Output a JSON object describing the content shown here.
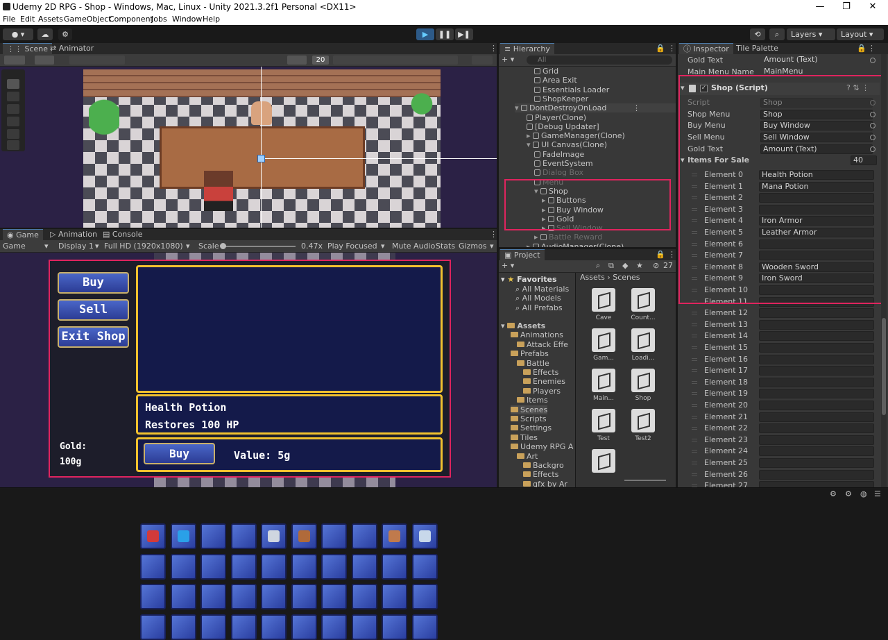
{
  "window": {
    "title": "Udemy 2D RPG - Shop - Windows, Mac, Linux - Unity 2021.3.2f1 Personal <DX11>"
  },
  "menu": [
    "File",
    "Edit",
    "Assets",
    "GameObject",
    "Component",
    "Jobs",
    "Window",
    "Help"
  ],
  "toolbar": {
    "layers": "Layers",
    "layout": "Layout"
  },
  "scene": {
    "tab_scene": "Scene",
    "tab_animator": "Animator",
    "gizmo_count": "20"
  },
  "game": {
    "tab_game": "Game",
    "tab_animation": "Animation",
    "tab_console": "Console",
    "mode": "Game",
    "display": "Display 1",
    "resolution": "Full HD (1920x1080)",
    "scale_label": "Scale",
    "scale_value": "0.47x",
    "play_focused": "Play Focused",
    "mute": "Mute Audio",
    "stats": "Stats",
    "gizmos": "Gizmos"
  },
  "shop": {
    "buy": "Buy",
    "sell": "Sell",
    "exit": "Exit Shop",
    "item_name": "Health Potion",
    "item_desc": "Restores 100 HP",
    "buy_btn": "Buy",
    "value": "Value: 5g",
    "gold_label": "Gold:",
    "gold_value": "100g"
  },
  "hierarchy": {
    "title": "Hierarchy",
    "search": "All",
    "items": [
      {
        "label": "Grid",
        "dim": false
      },
      {
        "label": "Area Exit",
        "dim": false
      },
      {
        "label": "Essentials Loader",
        "dim": false
      },
      {
        "label": "ShopKeeper",
        "dim": false
      },
      {
        "label": "DontDestroyOnLoad",
        "dim": false
      },
      {
        "label": "Player(Clone)",
        "dim": false
      },
      {
        "label": "[Debug Updater]",
        "dim": false
      },
      {
        "label": "GameManager(Clone)",
        "dim": false
      },
      {
        "label": "UI Canvas(Clone)",
        "dim": false
      },
      {
        "label": "FadeImage",
        "dim": false
      },
      {
        "label": "EventSystem",
        "dim": false
      },
      {
        "label": "Dialog Box",
        "dim": true
      },
      {
        "label": "Menu",
        "dim": true
      },
      {
        "label": "Shop",
        "dim": false
      },
      {
        "label": "Buttons",
        "dim": false
      },
      {
        "label": "Buy Window",
        "dim": false
      },
      {
        "label": "Gold",
        "dim": false
      },
      {
        "label": "Sell Window",
        "dim": true
      },
      {
        "label": "Battle Reward",
        "dim": true
      },
      {
        "label": "AudioManager(Clone)",
        "dim": false
      }
    ]
  },
  "project": {
    "title": "Project",
    "count": "27",
    "favorites": "Favorites",
    "fav_items": [
      "All Materials",
      "All Models",
      "All Prefabs"
    ],
    "assets": "Assets",
    "tree": [
      "Animations",
      "Attack Effe",
      "Prefabs",
      "Battle",
      "Effects",
      "Enemies",
      "Players",
      "Items",
      "Scenes",
      "Scripts",
      "Settings",
      "Tiles",
      "Udemy RPG A",
      "Art",
      "Backgro",
      "Effects",
      "gfx by Ar"
    ],
    "breadcrumb": [
      "Assets",
      "Scenes"
    ],
    "files": [
      "Cave",
      "Count...",
      "Gam...",
      "Loadi...",
      "Main...",
      "Shop",
      "Test",
      "Test2",
      ""
    ]
  },
  "inspector": {
    "tab_inspector": "Inspector",
    "tab_tile": "Tile Palette",
    "top_rows": [
      {
        "k": "Gold Text",
        "v": "Amount (Text)"
      },
      {
        "k": "Main Menu Name",
        "v": "MainMenu"
      }
    ],
    "component": "Shop (Script)",
    "fields": [
      {
        "k": "Script",
        "v": "Shop"
      },
      {
        "k": "Shop Menu",
        "v": "Shop"
      },
      {
        "k": "Buy Menu",
        "v": "Buy Window"
      },
      {
        "k": "Sell Menu",
        "v": "Sell Window"
      },
      {
        "k": "Gold Text",
        "v": "Amount (Text)"
      }
    ],
    "items_label": "Items For Sale",
    "items_count": "40",
    "elements": [
      {
        "k": "Element 0",
        "v": "Health Potion"
      },
      {
        "k": "Element 1",
        "v": "Mana Potion"
      },
      {
        "k": "Element 2",
        "v": ""
      },
      {
        "k": "Element 3",
        "v": ""
      },
      {
        "k": "Element 4",
        "v": "Iron Armor"
      },
      {
        "k": "Element 5",
        "v": "Leather Armor"
      },
      {
        "k": "Element 6",
        "v": ""
      },
      {
        "k": "Element 7",
        "v": ""
      },
      {
        "k": "Element 8",
        "v": "Wooden Sword"
      },
      {
        "k": "Element 9",
        "v": "Iron Sword"
      },
      {
        "k": "Element 10",
        "v": ""
      },
      {
        "k": "Element 11",
        "v": ""
      },
      {
        "k": "Element 12",
        "v": ""
      },
      {
        "k": "Element 13",
        "v": ""
      },
      {
        "k": "Element 14",
        "v": ""
      },
      {
        "k": "Element 15",
        "v": ""
      },
      {
        "k": "Element 16",
        "v": ""
      },
      {
        "k": "Element 17",
        "v": ""
      },
      {
        "k": "Element 18",
        "v": ""
      },
      {
        "k": "Element 19",
        "v": ""
      },
      {
        "k": "Element 20",
        "v": ""
      },
      {
        "k": "Element 21",
        "v": ""
      },
      {
        "k": "Element 22",
        "v": ""
      },
      {
        "k": "Element 23",
        "v": ""
      },
      {
        "k": "Element 24",
        "v": ""
      },
      {
        "k": "Element 25",
        "v": ""
      },
      {
        "k": "Element 26",
        "v": ""
      },
      {
        "k": "Element 27",
        "v": ""
      }
    ]
  },
  "colors": {
    "highlight": "#e0245e",
    "gold_border": "#f2c12e",
    "shop_bg": "#141a4a",
    "accent": "#4c7aa8"
  }
}
